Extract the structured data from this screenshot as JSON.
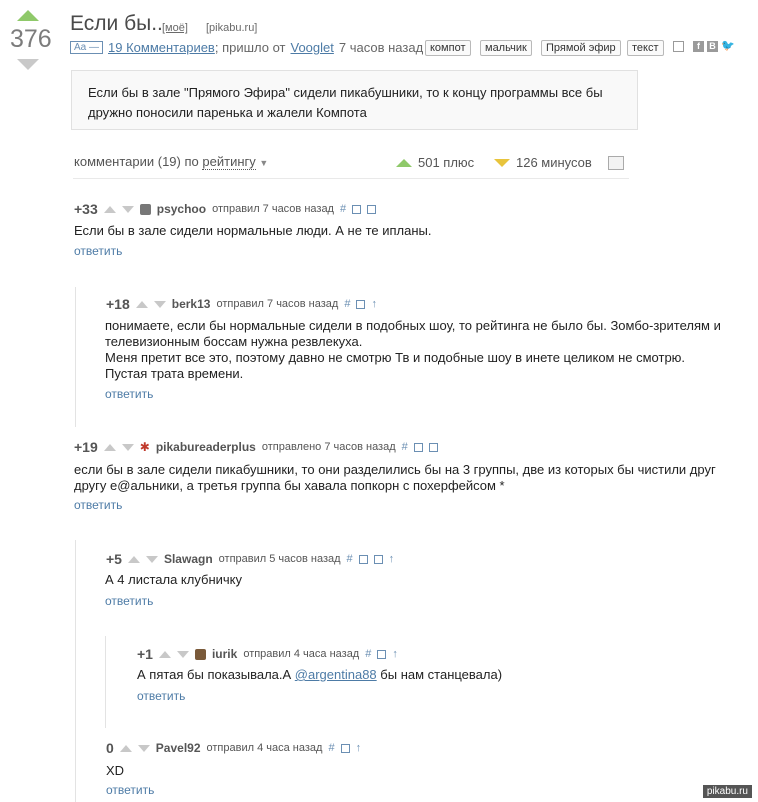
{
  "post": {
    "rating": "376",
    "title": "Если бы..",
    "tag_mine": "[моё]",
    "tag_source": "[pikabu.ru]",
    "font_toggle": "Aa —",
    "comments_link": "19 Комментариев",
    "meta_mid": "; пришло от",
    "author": "Vooglet",
    "time": "7 часов назад",
    "tags": [
      "компот",
      "мальчик",
      "Прямой эфир",
      "текст"
    ],
    "text": "Если бы в зале \"Прямого Эфира\" сидели пикабушники, то к концу программы все бы дружно поносили паренька и жалели Компота"
  },
  "sort": {
    "prefix": "комментарии (19) по",
    "by": "рейтингу",
    "plus": "501 плюс",
    "minus": "126 минусов"
  },
  "comments": [
    {
      "score": "+33",
      "nick": "psychoo",
      "when": "отправил 7 часов назад",
      "text": "Если бы в зале сидели нормальные люди. А не те ипланы.",
      "reply": "ответить"
    },
    {
      "score": "+18",
      "nick": "berk13",
      "when": "отправил 7 часов назад",
      "text1": "понимаете, если бы нормальные сидели в подобных шоу, то рейтинга не было бы. Зомбо-зрителям и телевизионным боссам нужна резвлекуха.",
      "text2": "Меня претит все это, поэтому давно не смотрю Тв и подобные шоу в инете целиком не смотрю. Пустая трата времени.",
      "reply": "ответить"
    },
    {
      "score": "+19",
      "nick": "pikabureaderplus",
      "when": "отправлено 7 часов назад",
      "text": "если бы в зале сидели пикабушники, то они разделились бы на 3 группы, две из которых бы чистили друг другу е@альники, а третья группа бы хавала попкорн с похерфейсом *",
      "reply": "ответить"
    },
    {
      "score": "+5",
      "nick": "Slawagn",
      "when": "отправил 5 часов назад",
      "text": "А 4 листала клубничку",
      "reply": "ответить"
    },
    {
      "score": "+1",
      "nick": "iurik",
      "when": "отправил 4 часа назад",
      "text_a": "А пятая бы показывала.А",
      "mention": "@argentina88",
      "text_b": "бы нам станцевала)",
      "reply": "ответить"
    },
    {
      "score": "0",
      "nick": "Pavel92",
      "when": "отправил 4 часа назад",
      "text": "XD",
      "reply": "ответить"
    }
  ],
  "watermark": "pikabu.ru",
  "colors": {
    "accent_green": "#8fc96a",
    "link_blue": "#4d7ba6",
    "minus_yellow": "#e8c43c"
  }
}
